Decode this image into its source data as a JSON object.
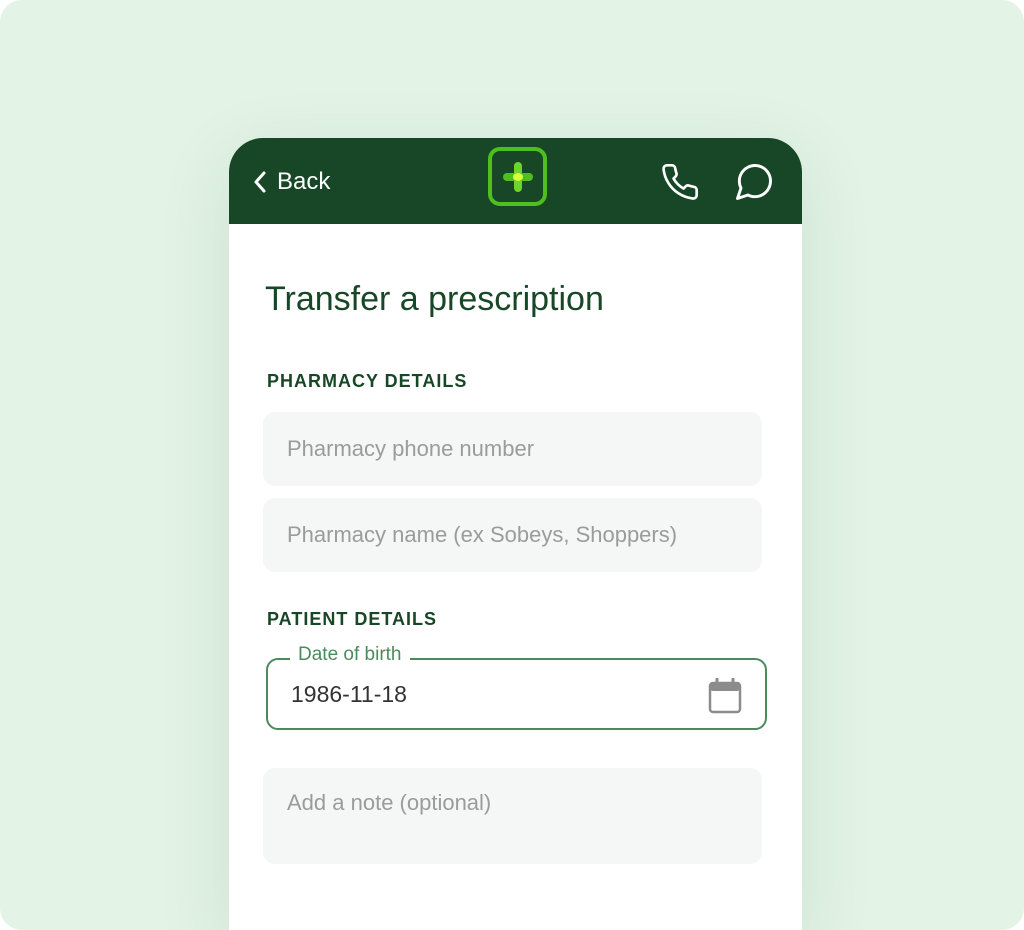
{
  "header": {
    "back_label": "Back",
    "logo_icon": "plus-cross-logo-icon",
    "phone_icon": "phone-icon",
    "chat_icon": "chat-bubble-icon",
    "bar_color": "#174726",
    "logo_color": "#4fbf1f"
  },
  "page": {
    "title": "Transfer a prescription"
  },
  "pharmacy": {
    "heading": "PHARMACY DETAILS",
    "phone_placeholder": "Pharmacy phone number",
    "name_placeholder": "Pharmacy name (ex Sobeys, Shoppers)"
  },
  "patient": {
    "heading": "PATIENT DETAILS",
    "dob_label": "Date of birth",
    "dob_value": "1986-11-18",
    "calendar_icon": "calendar-icon",
    "note_placeholder": "Add a note (optional)"
  },
  "colors": {
    "accent": "#4c8a5d",
    "background": "#e3f3e6",
    "text_dark": "#174726"
  }
}
